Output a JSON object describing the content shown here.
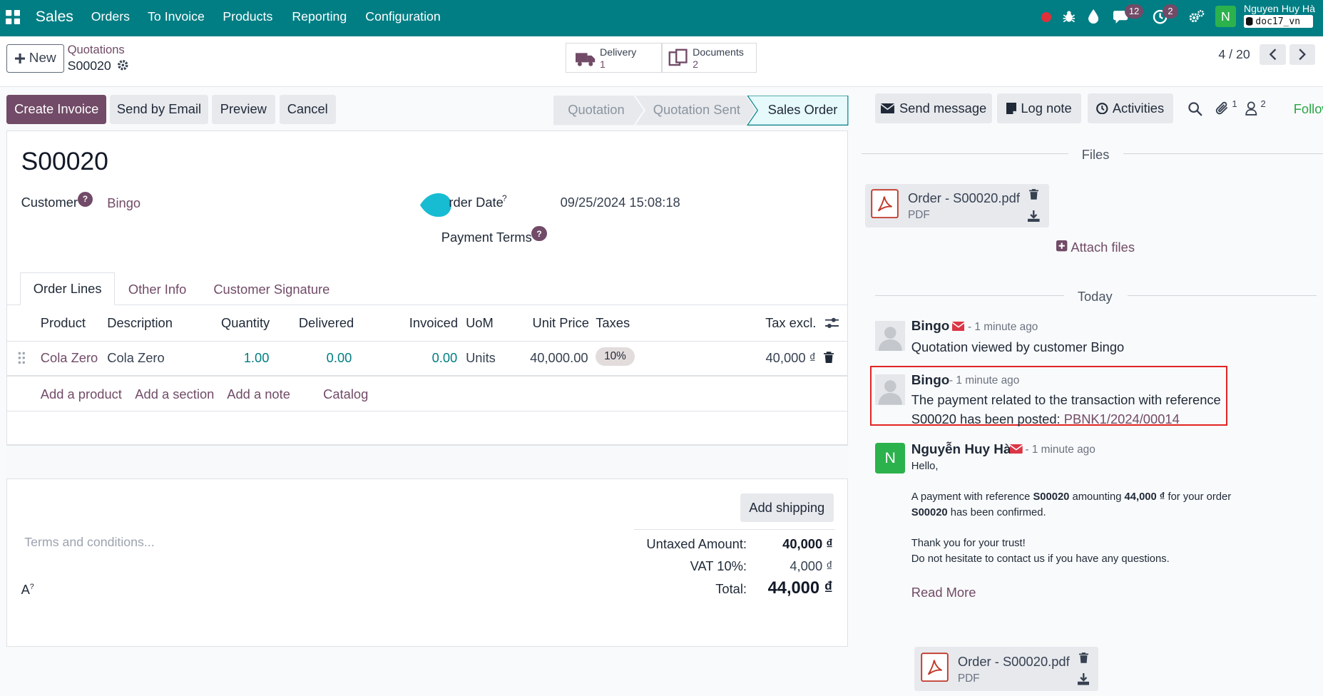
{
  "topbar": {
    "app_name": "Sales",
    "menus": [
      "Orders",
      "To Invoice",
      "Products",
      "Reporting",
      "Configuration"
    ],
    "messages_badge": "12",
    "activities_badge": "2",
    "user_initial": "N",
    "user_name": "Nguyen Huy Hà",
    "database": "doc17_vn",
    "accent_color": "#017e84"
  },
  "control": {
    "new_label": "New",
    "breadcrumb_parent": "Quotations",
    "record_name": "S00020",
    "delivery_label": "Delivery",
    "delivery_count": "1",
    "documents_label": "Documents",
    "documents_count": "2",
    "pager": "4 / 20"
  },
  "actions": {
    "create_invoice": "Create Invoice",
    "send_by_email": "Send by Email",
    "preview": "Preview",
    "cancel": "Cancel"
  },
  "statusbar": {
    "stages": [
      "Quotation",
      "Quotation Sent",
      "Sales Order"
    ],
    "active_stage": "Sales Order"
  },
  "form": {
    "title": "S00020",
    "customer_label": "Customer",
    "customer_value": "Bingo",
    "order_date_label": "rder Date",
    "order_date_value": "09/25/2024 15:08:18",
    "payment_terms_label": "Payment Terms",
    "help_marker": "?",
    "tabs": [
      "Order Lines",
      "Other Info",
      "Customer Signature"
    ],
    "active_tab": "Order Lines"
  },
  "order_lines": {
    "columns": [
      "Product",
      "Description",
      "Quantity",
      "Delivered",
      "Invoiced",
      "UoM",
      "Unit Price",
      "Taxes",
      "Tax excl."
    ],
    "rows": [
      {
        "product": "Cola Zero",
        "description": "Cola Zero",
        "quantity": "1.00",
        "delivered": "0.00",
        "invoiced": "0.00",
        "uom": "Units",
        "unit_price": "40,000.00",
        "taxes": "10%",
        "subtotal": "40,000 ₫"
      }
    ],
    "add_product": "Add a product",
    "add_section": "Add a section",
    "add_note": "Add a note",
    "catalog": "Catalog"
  },
  "totals": {
    "add_shipping": "Add shipping",
    "terms_placeholder": "Terms and conditions...",
    "untaxed_label": "Untaxed Amount:",
    "untaxed_value": "40,000 ₫",
    "vat_label": "VAT 10%:",
    "vat_value": "4,000 ₫",
    "total_label": "Total:",
    "total_value": "44,000 ₫",
    "font_marker": "A"
  },
  "chatter": {
    "send_message": "Send message",
    "log_note": "Log note",
    "activities": "Activities",
    "attachments_count": "1",
    "followers_count": "2",
    "follow": "Follow",
    "files_header": "Files",
    "file_name": "Order - S00020.pdf",
    "file_type": "PDF",
    "attach_files": "Attach files",
    "today": "Today",
    "messages": [
      {
        "author": "Bingo",
        "time": "- 1 minute ago",
        "body": "Quotation viewed by customer Bingo"
      },
      {
        "author": "Bingo",
        "time": "- 1 minute ago",
        "body_line1": "The payment related to the transaction with reference",
        "body_line2_prefix": "S00020 has been posted: ",
        "body_link": "PBNK1/2024/00014"
      },
      {
        "author": "Nguyễn Huy Hà",
        "initial": "N",
        "time": "- 1 minute ago",
        "greeting": "Hello,",
        "line1_a": "A payment with reference ",
        "line1_ref": "S00020",
        "line1_b": " amounting ",
        "line1_amount": "44,000 ₫",
        "line1_c": " for your order",
        "line2_ref": "S00020",
        "line2_b": " has been confirmed.",
        "thanks": "Thank you for your trust!",
        "contact": "Do not hesitate to contact us if you have any questions.",
        "read_more": "Read More"
      }
    ]
  }
}
